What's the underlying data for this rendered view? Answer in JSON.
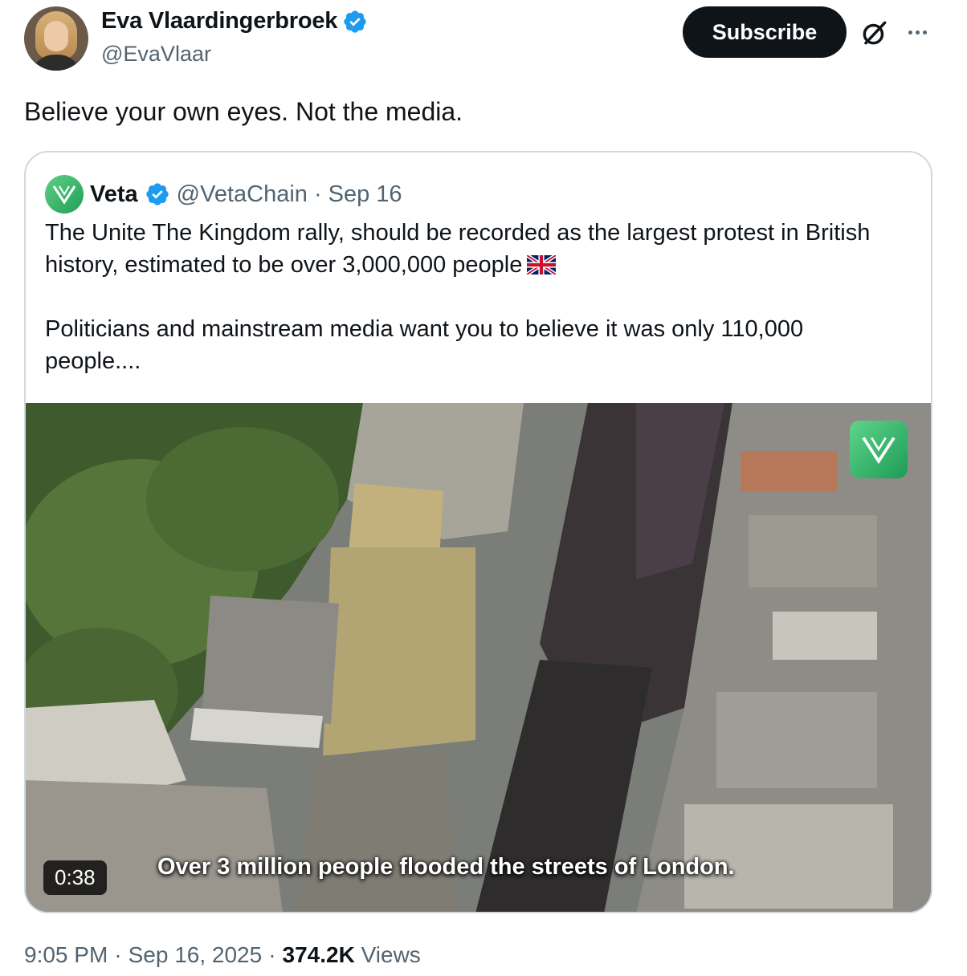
{
  "author": {
    "display_name": "Eva Vlaardingerbroek",
    "handle": "@EvaVlaar",
    "avatar": "profile-photo"
  },
  "actions": {
    "subscribe_label": "Subscribe",
    "grok_icon": "grok-icon",
    "more_icon": "more-icon"
  },
  "tweet": {
    "text": "Believe your own eyes. Not the media."
  },
  "quoted": {
    "name": "Veta",
    "handle": "@VetaChain",
    "separator": "·",
    "date": "Sep 16",
    "paragraph_1": "The Unite The Kingdom rally, should be recorded as the largest protest in British history, estimated to be over 3,000,000 people",
    "flag": "uk-flag-emoji",
    "paragraph_2": "Politicians and mainstream media want you to believe it was only 110,000 people....",
    "video": {
      "duration": "0:38",
      "caption": "Over 3 million people flooded the streets of London.",
      "watermark": "veta-logo"
    }
  },
  "footer": {
    "time": "9:05 PM",
    "sep1": "·",
    "date": "Sep 16, 2025",
    "sep2": "·",
    "views_count": "374.2K",
    "views_label": "Views"
  },
  "colors": {
    "text": "#0f1419",
    "secondary": "#536471",
    "verified": "#1d9bf0",
    "border": "#cfd9de",
    "veta_green": "#2fb566"
  }
}
